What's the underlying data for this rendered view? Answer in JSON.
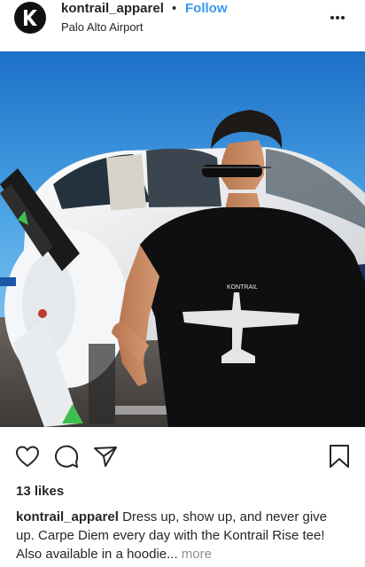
{
  "post": {
    "username": "kontrail_apparel",
    "separator": "•",
    "follow_label": "Follow",
    "location": "Palo Alto Airport",
    "shirt_text": "KONTRAIL",
    "likes": "13 likes",
    "caption": {
      "username": "kontrail_apparel",
      "line1": "Dress up, show up, and never give",
      "line2": "up. Carpe Diem every day with the Kontrail Rise tee!",
      "line3": "Also available in a hoodie...",
      "more_label": "more"
    }
  },
  "icons": {
    "avatar": "kontrail-k-logo",
    "more": "more-options-icon",
    "like": "heart-icon",
    "comment": "comment-icon",
    "share": "share-icon",
    "save": "bookmark-icon"
  },
  "colors": {
    "follow": "#3897f0",
    "text": "#262626",
    "muted": "#8e8e8e"
  }
}
